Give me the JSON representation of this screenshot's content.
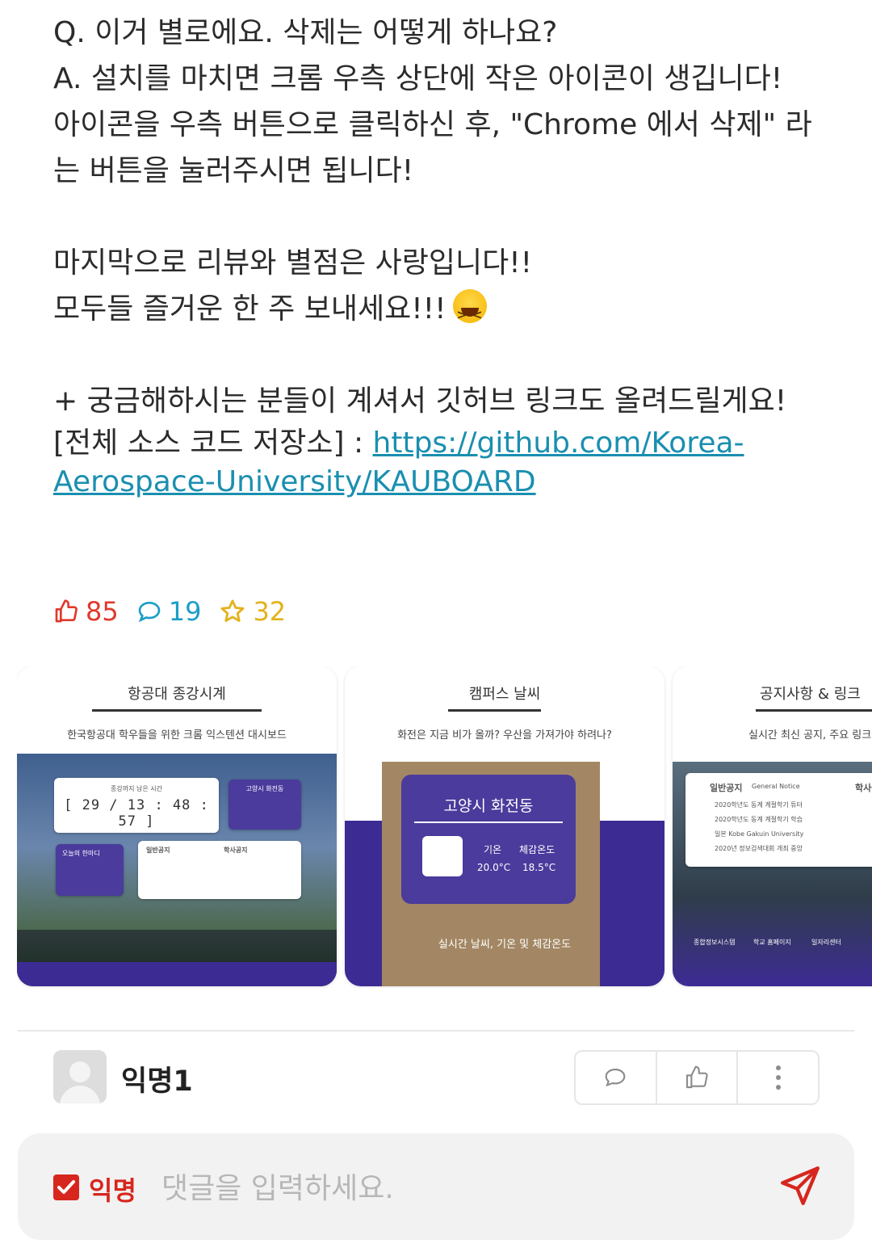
{
  "post": {
    "lines": [
      "Q. 이거 별로에요. 삭제는 어떻게 하나요?",
      "A. 설치를 마치면 크롬 우측 상단에 작은 아이콘이 생깁니다!",
      "아이콘을 우측 버튼으로 클릭하신 후, \"Chrome 에서 삭제\" 라는 버튼을 눌러주시면 됩니다!",
      "마지막으로 리뷰와 별점은 사랑입니다!!",
      "모두들 즐거운 한 주 보내세요!!!",
      "+ 궁금해하시는 분들이 계셔서 깃허브 링크도 올려드릴게요!",
      "[전체 소스 코드 저장소] : "
    ],
    "repo_link": "https://github.com/Korea-Aerospace-University/KAUBOARD",
    "emoji": "laughing-face-icon"
  },
  "stats": {
    "likes": "85",
    "comments": "19",
    "scraps": "32"
  },
  "gallery": [
    {
      "title": "항공대 종강시계",
      "subtitle": "한국항공대 학우들을 위한 크롬 익스텐션 대시보드",
      "clock_caption": "종강까지 남은 시간",
      "clock": "[ 29 / 13 : 48 : 57 ]",
      "weather_mini": "고양시 화전동",
      "notice_title": "일반공지",
      "academic_title": "학사공지",
      "today_title": "오늘의 한마디"
    },
    {
      "title": "캠퍼스 날씨",
      "subtitle": "화전은 지금 비가 올까? 우산을 가져가야 하려나?",
      "city": "고양시 화전동",
      "temp_label": "기온",
      "feels_label": "체감온도",
      "temp": "20.0°C",
      "feels": "18.5°C",
      "caption": "실시간 날씨, 기온 및 체감온도"
    },
    {
      "title": "공지사항 & 링크",
      "subtitle": "실시간 최신 공지, 주요 링크들",
      "notice_title": "일반공지",
      "notice_sub": "General Notice",
      "academic_title": "학사공지",
      "notices": [
        "2020학년도 동계 계절학기 튜터",
        "2020학년도 동계 계절학기 학습",
        "일본 Kobe Gakuin University",
        "2020년 정보검색대회 개최 중앙"
      ],
      "links": [
        "종합정보시스템",
        "학교 홈페이지",
        "일자리센터"
      ]
    }
  ],
  "comment": {
    "author": "익명1"
  },
  "input": {
    "anon_label": "익명",
    "placeholder": "댓글을 입력하세요."
  },
  "colors": {
    "like": "#e0392b",
    "comment": "#1c9dc8",
    "scrap": "#e3b21c",
    "accent": "#d7261e",
    "link": "#1a8fb0",
    "panel_purple": "#3d2b94"
  }
}
